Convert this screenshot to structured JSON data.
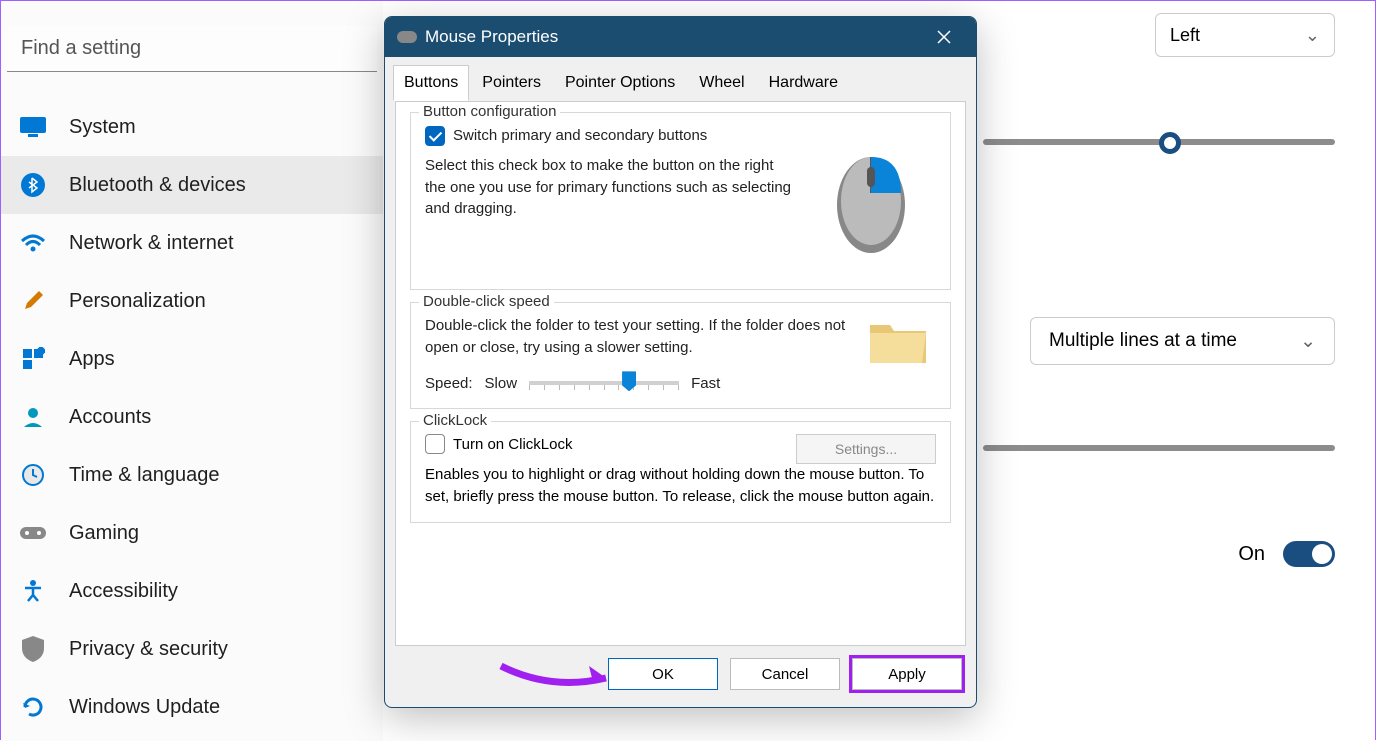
{
  "search": {
    "placeholder": "Find a setting"
  },
  "sidebar": {
    "items": [
      {
        "label": "System"
      },
      {
        "label": "Bluetooth & devices"
      },
      {
        "label": "Network & internet"
      },
      {
        "label": "Personalization"
      },
      {
        "label": "Apps"
      },
      {
        "label": "Accounts"
      },
      {
        "label": "Time & language"
      },
      {
        "label": "Gaming"
      },
      {
        "label": "Accessibility"
      },
      {
        "label": "Privacy & security"
      },
      {
        "label": "Windows Update"
      }
    ]
  },
  "content": {
    "primary_button_dropdown": "Left",
    "scroll_dropdown": "Multiple lines at a time",
    "toggle_label": "On"
  },
  "dialog": {
    "title": "Mouse Properties",
    "tabs": [
      "Buttons",
      "Pointers",
      "Pointer Options",
      "Wheel",
      "Hardware"
    ],
    "button_config": {
      "group_title": "Button configuration",
      "checkbox_label": "Switch primary and secondary buttons",
      "description": "Select this check box to make the button on the right the one you use for primary functions such as selecting and dragging."
    },
    "double_click": {
      "group_title": "Double-click speed",
      "description": "Double-click the folder to test your setting. If the folder does not open or close, try using a slower setting.",
      "speed_label": "Speed:",
      "slow": "Slow",
      "fast": "Fast"
    },
    "clicklock": {
      "group_title": "ClickLock",
      "checkbox_label": "Turn on ClickLock",
      "settings_btn": "Settings...",
      "description": "Enables you to highlight or drag without holding down the mouse button. To set, briefly press the mouse button. To release, click the mouse button again."
    },
    "buttons": {
      "ok": "OK",
      "cancel": "Cancel",
      "apply": "Apply"
    }
  }
}
